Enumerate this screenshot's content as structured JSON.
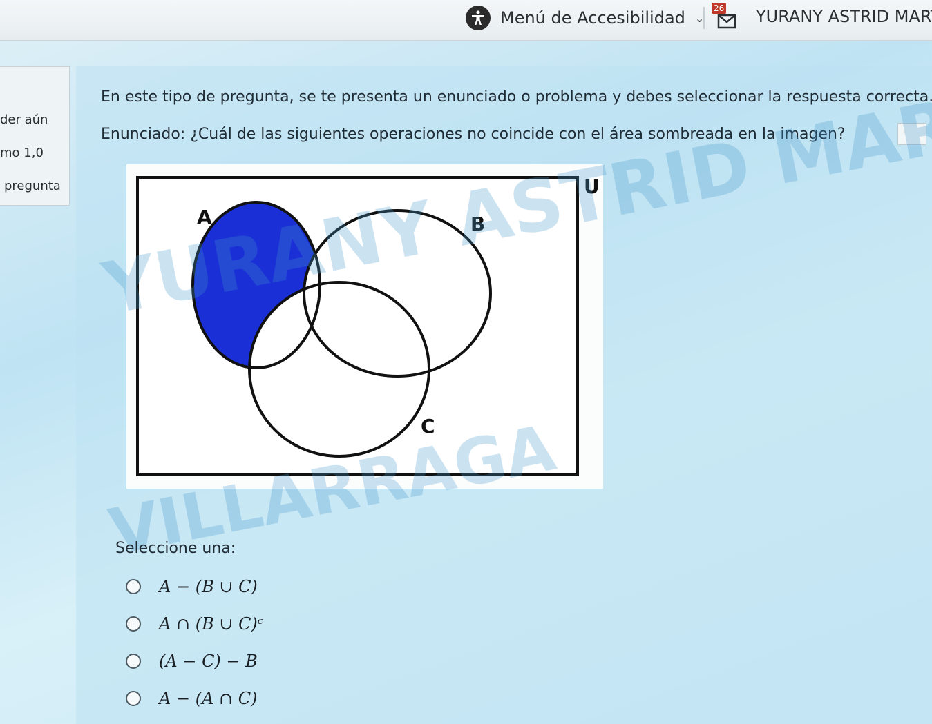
{
  "topbar": {
    "accessibility_label": "Menú de Accesibilidad",
    "messages_count": "26",
    "user_name": "YURANY ASTRID MART"
  },
  "sidebar": {
    "lines": [
      "der aún",
      "mo 1,0",
      "pregunta"
    ]
  },
  "question": {
    "instruction": "En este tipo de pregunta, se te presenta un enunciado o problema y debes seleccionar la respuesta correcta.",
    "statement": "Enunciado: ¿Cuál de las siguientes operaciones no coincide con el área sombreada en la imagen?",
    "figure": {
      "universe_label": "U",
      "set_a_label": "A",
      "set_b_label": "B",
      "set_c_label": "C",
      "shade_color": "#1a2fd6"
    },
    "watermark": {
      "line1": "YURANY ASTRID MARTIN",
      "line2": "VILLARRAGA"
    },
    "select_label": "Seleccione una:",
    "options": [
      {
        "label": "A − (B ∪ C)"
      },
      {
        "label": "A ∩ (B ∪ C)ᶜ"
      },
      {
        "label": "(A − C) − B"
      },
      {
        "label": "A − (A ∩ C)"
      }
    ]
  }
}
